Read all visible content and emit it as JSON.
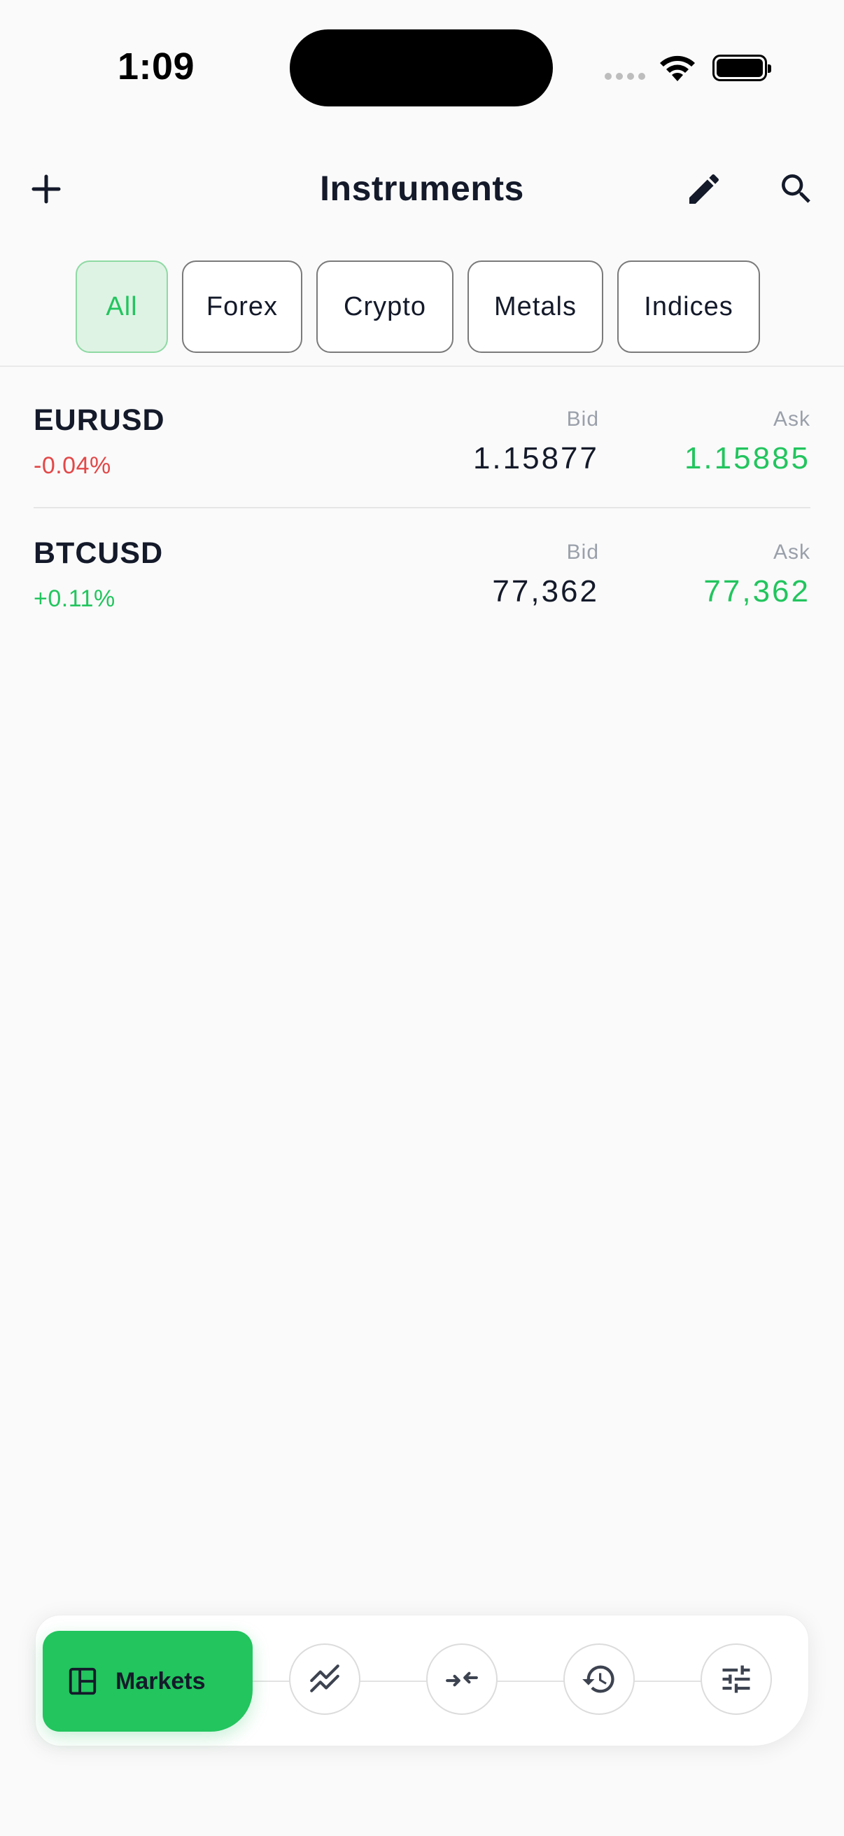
{
  "status_bar": {
    "time": "1:09"
  },
  "header": {
    "title": "Instruments"
  },
  "filters": [
    {
      "label": "All",
      "active": true
    },
    {
      "label": "Forex",
      "active": false
    },
    {
      "label": "Crypto",
      "active": false
    },
    {
      "label": "Metals",
      "active": false
    },
    {
      "label": "Indices",
      "active": false
    }
  ],
  "instruments": [
    {
      "symbol": "EURUSD",
      "change": "-0.04%",
      "bid_label": "Bid",
      "bid": "1.15877",
      "ask_label": "Ask",
      "ask": "1.15885"
    },
    {
      "symbol": "BTCUSD",
      "change": "+0.11%",
      "bid_label": "Bid",
      "bid": "77,362",
      "ask_label": "Ask",
      "ask": "77,362"
    }
  ],
  "bottom_nav": {
    "active_label": "Markets",
    "items": [
      "markets-icon",
      "chart-icon",
      "trade-icon",
      "history-icon",
      "settings-icon"
    ]
  },
  "colors": {
    "accent": "#22c55e",
    "negative": "#e34848",
    "text": "#141a2a",
    "muted": "#9aa0aa"
  }
}
